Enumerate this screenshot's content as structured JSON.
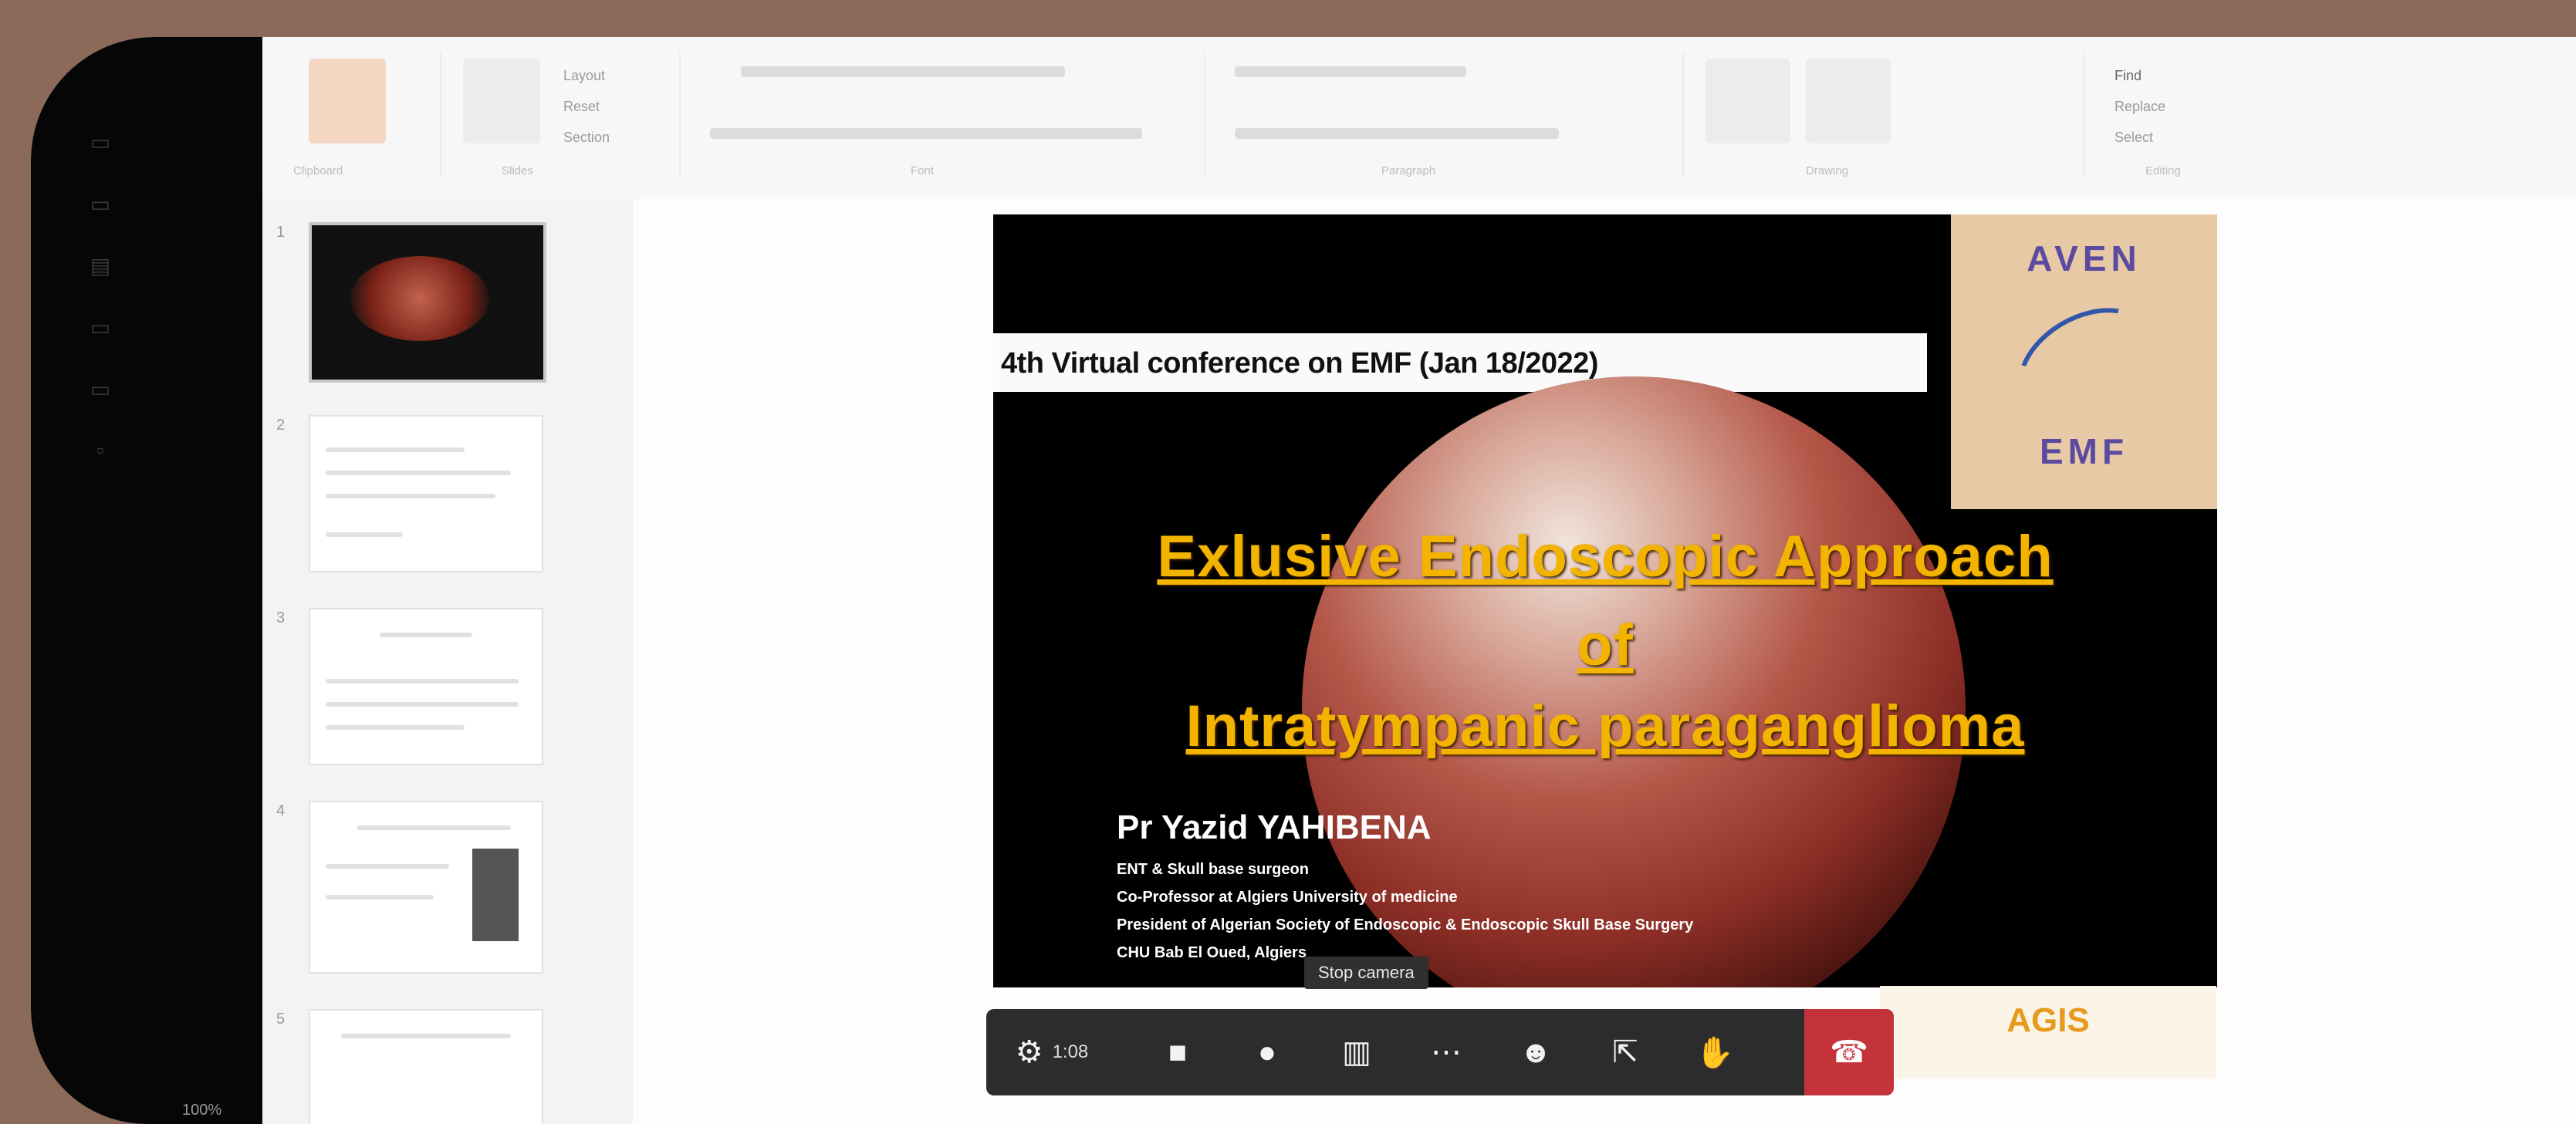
{
  "app": {
    "ribbon_groups": [
      "Clipboard",
      "Slides",
      "Font",
      "Paragraph",
      "Drawing",
      "Editing"
    ],
    "ribbon_commands": [
      "Layout",
      "Reset",
      "Section",
      "Find",
      "Replace",
      "Select"
    ],
    "thumbnail_numbers": [
      "1",
      "2",
      "3",
      "4",
      "5"
    ]
  },
  "slide": {
    "conference_band": "4th Virtual conference on EMF (Jan 18/2022)",
    "title_line1": "Exlusive Endoscopic Approach",
    "title_line2": "of",
    "title_line3": "Intratympanic paraganglioma",
    "author": "Pr Yazid YAHIBENA",
    "affiliations": [
      "ENT & Skull base surgeon",
      "Co-Professor at Algiers University of medicine",
      "President of Algerian Society of Endoscopic & Endoscopic Skull Base Surgery",
      "CHU Bab El Oued, Algiers"
    ],
    "logo_top": "AVEN",
    "logo_bottom": "EMF",
    "bottom_logo": "AGIS",
    "colors": {
      "title": "#f3b400",
      "band_bg": "#fafafa",
      "logo_bg": "#e8c9a6"
    }
  },
  "meeting_toolbar": {
    "tooltip": "Stop camera",
    "participant_count": "1:08",
    "buttons": [
      {
        "name": "info-icon"
      },
      {
        "name": "camera-icon"
      },
      {
        "name": "microphone-icon"
      },
      {
        "name": "layout-icon"
      },
      {
        "name": "more-icon"
      },
      {
        "name": "participants-icon"
      },
      {
        "name": "share-screen-icon"
      },
      {
        "name": "raise-hand-icon"
      },
      {
        "name": "end-call-icon"
      }
    ],
    "end_color": "#c4323a"
  },
  "status": {
    "corner_text": "100%"
  }
}
